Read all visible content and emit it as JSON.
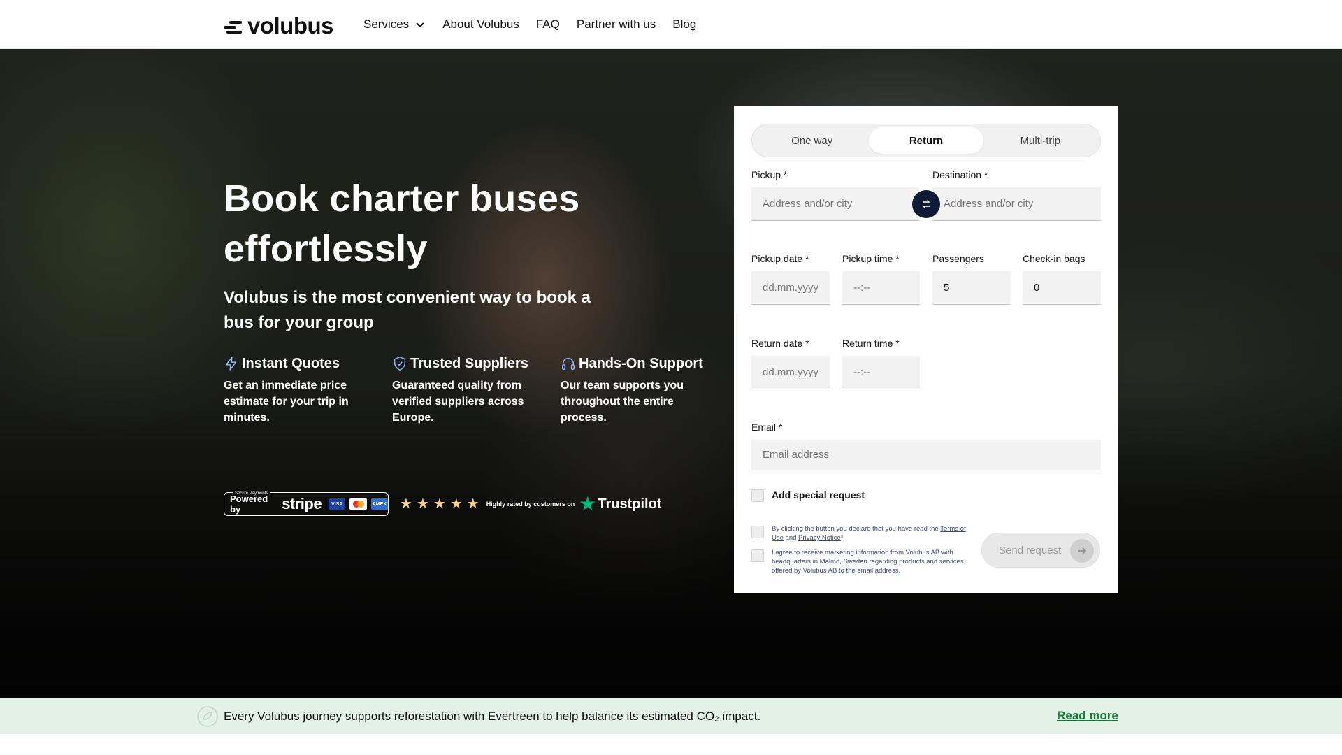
{
  "nav": {
    "logo_text": "volubus",
    "links": [
      {
        "label": "Services"
      },
      {
        "label": "About Volubus"
      },
      {
        "label": "FAQ"
      },
      {
        "label": "Partner with us"
      },
      {
        "label": "Blog"
      }
    ]
  },
  "hero": {
    "title": "Book charter buses effortlessly",
    "subtitle": "Volubus is the most convenient way to book a bus for your group",
    "features": [
      {
        "icon": "lightning-icon",
        "title": "Instant Quotes",
        "text": "Get an immediate price estimate for your trip in minutes."
      },
      {
        "icon": "shield-check-icon",
        "title": "Trusted Suppliers",
        "text": "Guaranteed quality from verified suppliers across Europe."
      },
      {
        "icon": "headphones-icon",
        "title": "Hands-On Support",
        "text": "Our team supports you throughout the entire process."
      }
    ],
    "stripe_badge": {
      "secure": "Secure Payments",
      "powered_by": "Powered by",
      "brand": "stripe",
      "visa": "VISA",
      "amex": "AMEX"
    },
    "trustpilot": {
      "rating_stars": 5,
      "rated_text": "Highly rated by customers on",
      "brand": "Trustpilot"
    }
  },
  "form": {
    "tabs": [
      {
        "label": "One way",
        "active": false
      },
      {
        "label": "Return",
        "active": true
      },
      {
        "label": "Multi-trip",
        "active": false
      }
    ],
    "pickup_label": "Pickup *",
    "pickup_placeholder": "Address and/or city",
    "destination_label": "Destination *",
    "destination_placeholder": "Address and/or city",
    "pickup_date_label": "Pickup date *",
    "pickup_date_placeholder": "dd.mm.yyyy",
    "pickup_time_label": "Pickup time *",
    "pickup_time_placeholder": "--:--",
    "passengers_label": "Passengers",
    "passengers_value": "5",
    "bags_label": "Check-in bags",
    "bags_value": "0",
    "return_date_label": "Return date *",
    "return_date_placeholder": "dd.mm.yyyy",
    "return_time_label": "Return time *",
    "return_time_placeholder": "--:--",
    "email_label": "Email *",
    "email_placeholder": "Email address",
    "special_request_label": "Add special request",
    "terms_pre": "By clicking the button you declare that you have read the ",
    "terms_link": "Terms of Use",
    "terms_and": " and ",
    "privacy_link": "Privacy Notice",
    "terms_post": "*",
    "marketing_text": "I agree to receive marketing information from Volubus AB with headquarters in Malmö, Sweden regarding products and services offered by Volubus AB to the email address.",
    "send_label": "Send request"
  },
  "banner": {
    "text": "Every Volubus journey supports reforestation with Evertreen to help balance its estimated CO₂ impact.",
    "link": "Read more"
  },
  "colors": {
    "swap_button": "#0e1a36",
    "trustpilot_green": "#00b67a",
    "banner_bg": "#e3f1e7",
    "link_green": "#1a7a3a"
  }
}
